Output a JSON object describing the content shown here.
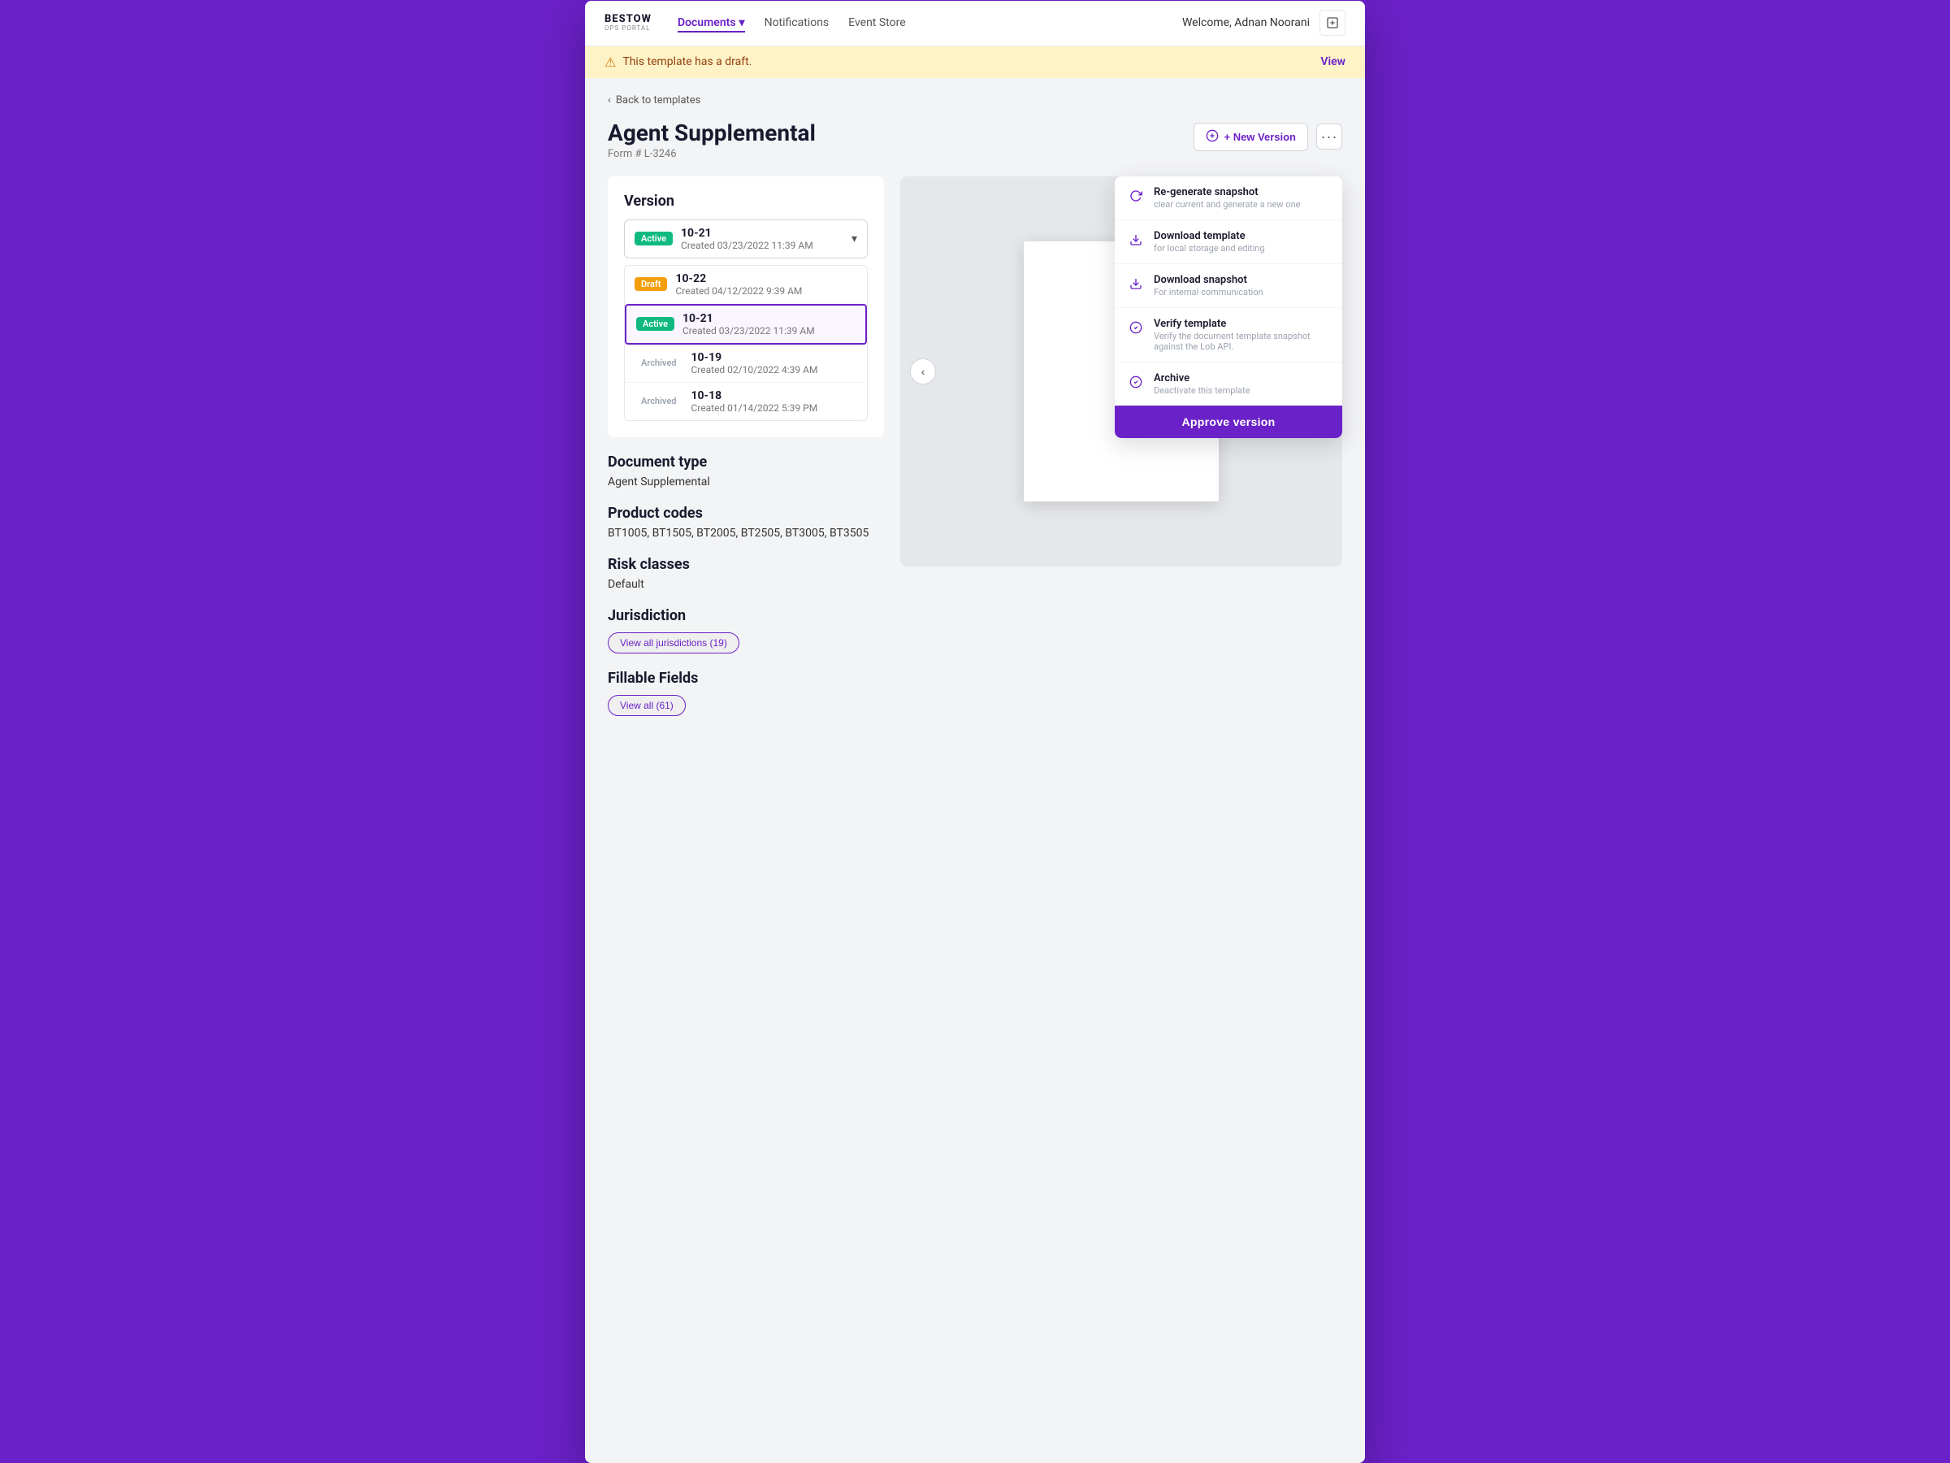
{
  "nav": {
    "logo_line1": "BESTOW",
    "logo_line2": "OPS PORTAL",
    "links": [
      {
        "label": "Documents",
        "active": true,
        "has_arrow": true
      },
      {
        "label": "Notifications",
        "active": false
      },
      {
        "label": "Event Store",
        "active": false
      }
    ],
    "welcome": "Welcome, Adnan Noorani"
  },
  "banner": {
    "message": "This template has a draft.",
    "link": "View"
  },
  "breadcrumb": "Back to templates",
  "page": {
    "title": "Agent Supplemental",
    "form_number": "Form # L-3246"
  },
  "header_actions": {
    "new_version_label": "+ New Version",
    "three_dots": "···"
  },
  "version_section": {
    "title": "Version",
    "current": {
      "badge": "Active",
      "badge_type": "active",
      "number": "10-21",
      "date": "Created 03/23/2022 11:39 AM"
    },
    "list": [
      {
        "badge": "Draft",
        "badge_type": "draft",
        "number": "10-22",
        "date": "Created 04/12/2022 9:39 AM",
        "selected": false
      },
      {
        "badge": "Active",
        "badge_type": "active",
        "number": "10-21",
        "date": "Created 03/23/2022 11:39 AM",
        "selected": true
      },
      {
        "badge": "Archived",
        "badge_type": "archived",
        "number": "10-19",
        "date": "Created 02/10/2022 4:39 AM",
        "selected": false
      },
      {
        "badge": "Archived",
        "badge_type": "archived",
        "number": "10-18",
        "date": "Created 01/14/2022 5:39 PM",
        "selected": false
      }
    ]
  },
  "document_type": {
    "label": "Document type",
    "value": "Agent Supplemental"
  },
  "product_codes": {
    "label": "Product codes",
    "value": "BT1005, BT1505, BT2005, BT2505, BT3005, BT3505"
  },
  "risk_classes": {
    "label": "Risk classes",
    "value": "Default"
  },
  "jurisdiction": {
    "label": "Jurisdiction",
    "btn_label": "View all jurisdictions (19)"
  },
  "fillable_fields": {
    "label": "Fillable Fields",
    "btn_label": "View all (61)"
  },
  "context_menu": {
    "items": [
      {
        "icon": "refresh",
        "title": "Re-generate snapshot",
        "desc": "clear current and generate a new one"
      },
      {
        "icon": "download",
        "title": "Download template",
        "desc": "for local storage and editing"
      },
      {
        "icon": "download2",
        "title": "Download snapshot",
        "desc": "For internal communication"
      },
      {
        "icon": "check",
        "title": "Verify template",
        "desc": "Verify the document template snapshot against the Lob API."
      },
      {
        "icon": "archive",
        "title": "Archive",
        "desc": "Deactivate this template"
      }
    ],
    "approve_btn": "Approve version"
  }
}
